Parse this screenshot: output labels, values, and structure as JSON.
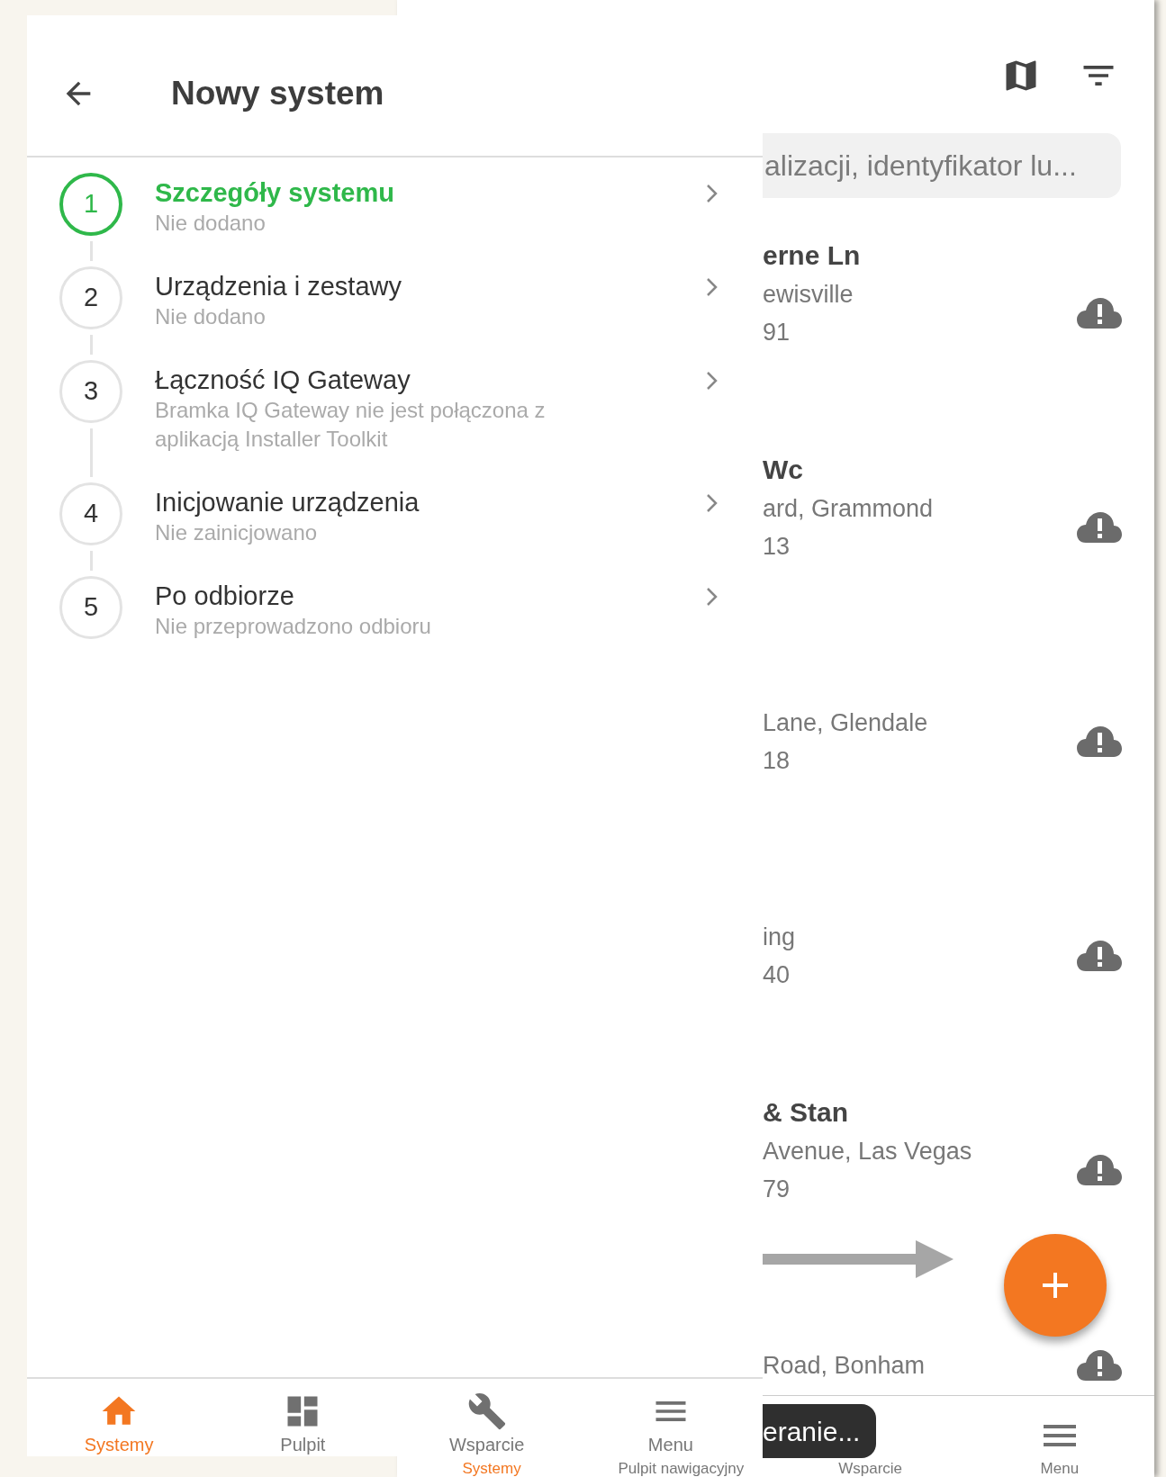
{
  "left_screen": {
    "title": "Nowy system",
    "steps": [
      {
        "number": "1",
        "title": "Szczegóły systemu",
        "status": "Nie dodano",
        "selected": true
      },
      {
        "number": "2",
        "title": "Urządzenia i zestawy",
        "status": "Nie dodano",
        "selected": false
      },
      {
        "number": "3",
        "title": "Łączność IQ Gateway",
        "status": "Bramka IQ Gateway nie jest połączona z aplikacją Installer Toolkit",
        "selected": false
      },
      {
        "number": "4",
        "title": "Inicjowanie urządzenia",
        "status": "Nie zainicjowano",
        "selected": false
      },
      {
        "number": "5",
        "title": "Po odbiorze",
        "status": "Nie przeprowadzono odbioru",
        "selected": false
      }
    ],
    "nav": [
      {
        "label": "Systemy",
        "kind": "home",
        "selected": true
      },
      {
        "label": "Pulpit",
        "kind": "dashboard",
        "selected": false
      },
      {
        "label": "Wsparcie",
        "kind": "wrench",
        "selected": false
      },
      {
        "label": "Menu",
        "kind": "menu",
        "selected": false
      }
    ]
  },
  "right_screen": {
    "search": {
      "placeholder": "alizacji, identyfikator lu..."
    },
    "systems": [
      {
        "name": "erne Ln",
        "address": "ewisville",
        "number": "91"
      },
      {
        "name": "Wc",
        "address": "ard, Grammond",
        "number": "13"
      },
      {
        "address": "Lane, Glendale",
        "number": "18"
      },
      {
        "address": "ing",
        "number": "40"
      },
      {
        "name": "& Stan",
        "address": "Avenue, Las Vegas",
        "number": "79"
      },
      {
        "address": "Road, Bonham"
      }
    ],
    "toast": "eranie...",
    "nav": [
      {
        "label": "Systemy",
        "kind": "plain",
        "selected": true
      },
      {
        "label": "Pulpit nawigacyjny",
        "kind": "plain",
        "selected": false
      },
      {
        "label": "Wsparcie",
        "kind": "plain",
        "selected": false
      },
      {
        "label": "Menu",
        "kind": "menu",
        "selected": false
      }
    ]
  }
}
